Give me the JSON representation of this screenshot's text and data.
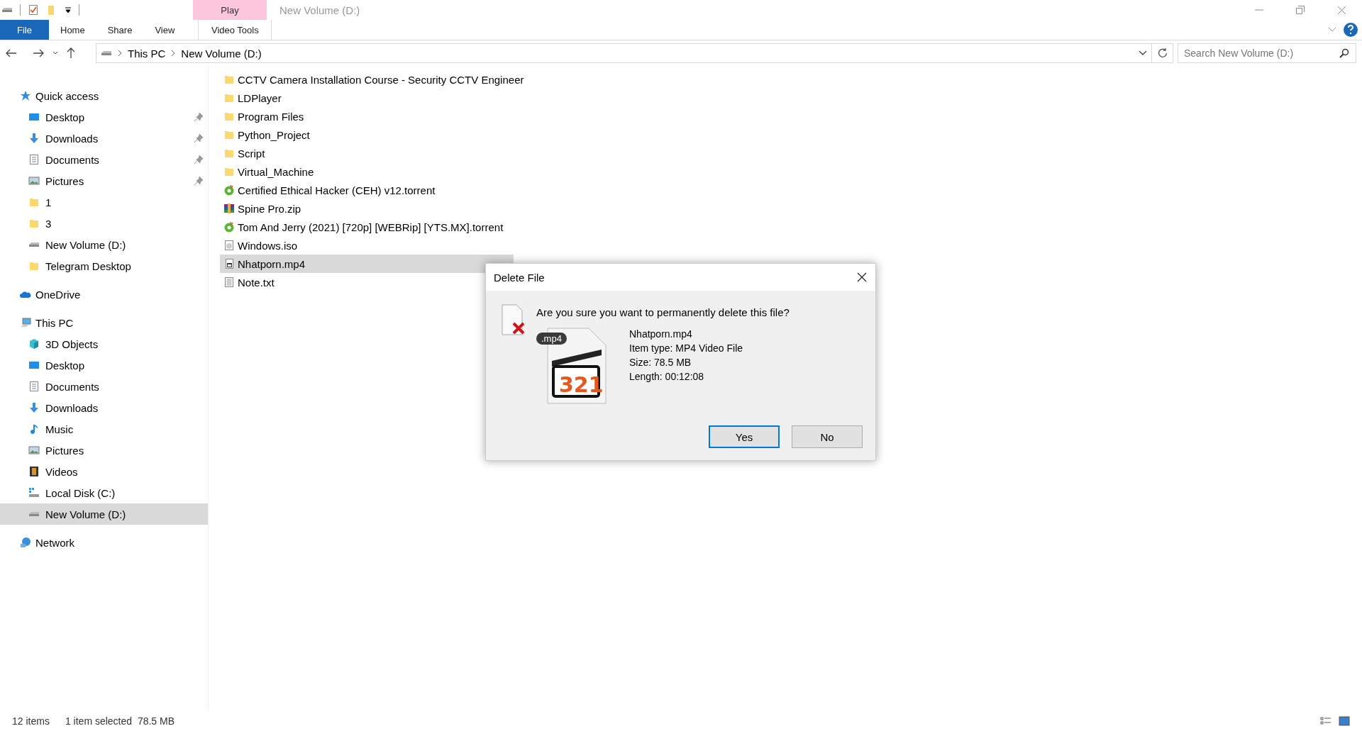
{
  "window": {
    "title": "New Volume (D:)",
    "contextual_tab": "Play"
  },
  "ribbon_tabs": [
    {
      "label": "File",
      "kind": "file",
      "selected": false
    },
    {
      "label": "Home",
      "kind": "plain",
      "selected": false
    },
    {
      "label": "Share",
      "kind": "plain",
      "selected": false
    },
    {
      "label": "View",
      "kind": "plain",
      "selected": false
    },
    {
      "label": "Video Tools",
      "kind": "contextual",
      "selected": false
    }
  ],
  "address_bar": {
    "crumbs": [
      "This PC",
      "New Volume (D:)"
    ]
  },
  "search": {
    "placeholder": "Search New Volume (D:)"
  },
  "sidebar": {
    "groups": [
      {
        "label": "Quick access",
        "kind": "star",
        "children": [
          {
            "label": "Desktop",
            "kind": "desktop",
            "pinned": true,
            "selected": false
          },
          {
            "label": "Downloads",
            "kind": "download",
            "pinned": true,
            "selected": false
          },
          {
            "label": "Documents",
            "kind": "document",
            "pinned": true,
            "selected": false
          },
          {
            "label": "Pictures",
            "kind": "picture",
            "pinned": true,
            "selected": false
          },
          {
            "label": "1",
            "kind": "folder",
            "pinned": false,
            "selected": false
          },
          {
            "label": "3",
            "kind": "folder",
            "pinned": false,
            "selected": false
          },
          {
            "label": "New Volume (D:)",
            "kind": "drive",
            "pinned": false,
            "selected": false
          },
          {
            "label": "Telegram Desktop",
            "kind": "folder",
            "pinned": false,
            "selected": false
          }
        ]
      },
      {
        "label": "OneDrive",
        "kind": "cloud"
      },
      {
        "label": "This PC",
        "kind": "pc",
        "children": [
          {
            "label": "3D Objects",
            "kind": "cube",
            "pinned": false,
            "selected": false
          },
          {
            "label": "Desktop",
            "kind": "desktop",
            "pinned": false,
            "selected": false
          },
          {
            "label": "Documents",
            "kind": "document",
            "pinned": false,
            "selected": false
          },
          {
            "label": "Downloads",
            "kind": "download",
            "pinned": false,
            "selected": false
          },
          {
            "label": "Music",
            "kind": "music",
            "pinned": false,
            "selected": false
          },
          {
            "label": "Pictures",
            "kind": "picture",
            "pinned": false,
            "selected": false
          },
          {
            "label": "Videos",
            "kind": "film",
            "pinned": false,
            "selected": false
          },
          {
            "label": "Local Disk (C:)",
            "kind": "sysdrive",
            "pinned": false,
            "selected": false
          },
          {
            "label": "New Volume (D:)",
            "kind": "drive",
            "pinned": false,
            "selected": true
          }
        ]
      },
      {
        "label": "Network",
        "kind": "network"
      }
    ]
  },
  "files": [
    {
      "name": "CCTV Camera Installation Course - Security CCTV Engineer",
      "kind": "folder",
      "selected": false
    },
    {
      "name": "LDPlayer",
      "kind": "folder",
      "selected": false
    },
    {
      "name": "Program Files",
      "kind": "folder",
      "selected": false
    },
    {
      "name": "Python_Project",
      "kind": "folder",
      "selected": false
    },
    {
      "name": "Script",
      "kind": "folder",
      "selected": false
    },
    {
      "name": "Virtual_Machine",
      "kind": "folder",
      "selected": false
    },
    {
      "name": "Certified Ethical Hacker (CEH) v12.torrent",
      "kind": "torrent",
      "selected": false
    },
    {
      "name": "Spine Pro.zip",
      "kind": "archive",
      "selected": false
    },
    {
      "name": "Tom And Jerry (2021) [720p] [WEBRip] [YTS.MX].torrent",
      "kind": "torrent",
      "selected": false
    },
    {
      "name": "Windows.iso",
      "kind": "disc",
      "selected": false
    },
    {
      "name": "Nhatporn.mp4",
      "kind": "video",
      "selected": true
    },
    {
      "name": "Note.txt",
      "kind": "text",
      "selected": false
    }
  ],
  "dialog": {
    "title": "Delete File",
    "question": "Are you sure you want to permanently delete this file?",
    "badge": ".mp4",
    "icon_text": "321",
    "details": [
      "Nhatporn.mp4",
      "Item type: MP4 Video File",
      "Size: 78.5 MB",
      "Length: 00:12:08"
    ],
    "buttons": [
      {
        "label": "Yes",
        "default": true
      },
      {
        "label": "No",
        "default": false
      }
    ]
  },
  "status_bar": {
    "items": "12 items",
    "selection": "1 item selected",
    "size": "78.5 MB"
  }
}
